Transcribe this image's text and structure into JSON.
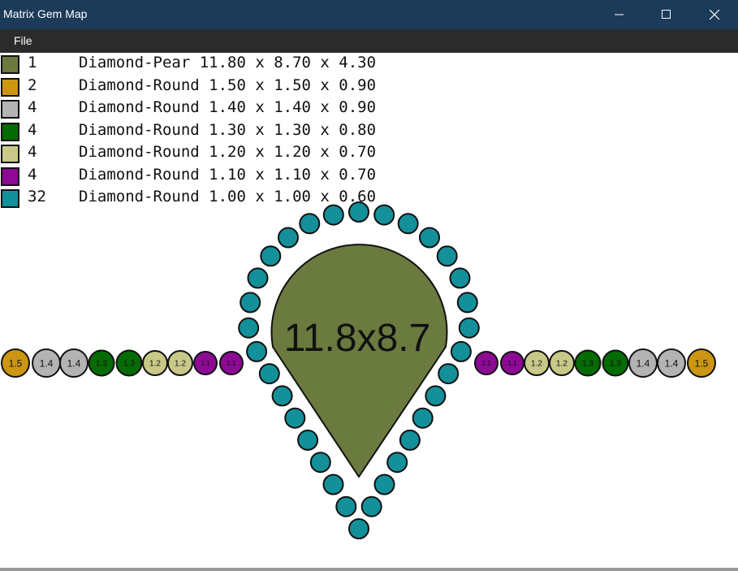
{
  "window": {
    "title": "Matrix Gem Map",
    "controls": [
      "minimize-icon",
      "maximize-icon",
      "close-icon"
    ]
  },
  "menu": {
    "file_label": "File"
  },
  "legend": [
    {
      "count": "1",
      "desc": "Diamond-Pear 11.80 x 8.70 x 4.30",
      "color": "#6b7a3f"
    },
    {
      "count": "2",
      "desc": "Diamond-Round 1.50 x 1.50 x 0.90",
      "color": "#cc9612"
    },
    {
      "count": "4",
      "desc": "Diamond-Round 1.40 x 1.40 x 0.90",
      "color": "#b3b3b3"
    },
    {
      "count": "4",
      "desc": "Diamond-Round 1.30 x 1.30 x 0.80",
      "color": "#056b05"
    },
    {
      "count": "4",
      "desc": "Diamond-Round 1.20 x 1.20 x 0.70",
      "color": "#c8c888"
    },
    {
      "count": "4",
      "desc": "Diamond-Round 1.10 x 1.10 x 0.70",
      "color": "#8c0a94"
    },
    {
      "count": "32",
      "desc": "Diamond-Round 1.00 x 1.00 x 0.60",
      "color": "#13909a"
    }
  ],
  "pear": {
    "label": "11.8x8.7",
    "color": "#6b7a3f"
  },
  "halo": {
    "count": 32,
    "label": "1",
    "color": "#13909a"
  },
  "side_stones": {
    "left": [
      "1.5",
      "1.4",
      "1.4",
      "1.3",
      "1.3",
      "1.2",
      "1.2",
      "1.1",
      "1.1"
    ],
    "right": [
      "1.1",
      "1.1",
      "1.2",
      "1.2",
      "1.3",
      "1.3",
      "1.4",
      "1.4",
      "1.5"
    ]
  },
  "size_colors": {
    "1.5": "#cc9612",
    "1.4": "#b3b3b3",
    "1.3": "#056b05",
    "1.2": "#c8c888",
    "1.1": "#8c0a94",
    "1": "#13909a"
  }
}
